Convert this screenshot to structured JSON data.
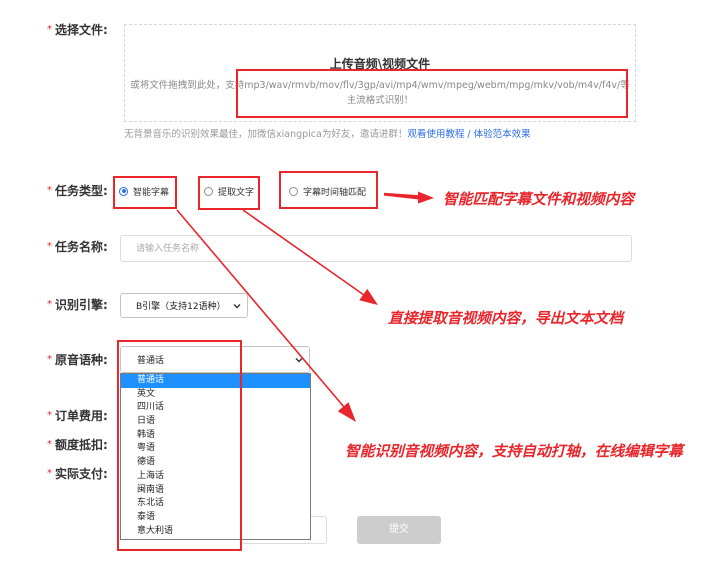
{
  "colors": {
    "annotation": "#e8262c",
    "required": "#e8262c",
    "accent": "#2f6fe4",
    "link": "#2f6fe4",
    "option_highlight": "#1e90ff",
    "submit_disabled": "#cdcdcd"
  },
  "required_mark": "*",
  "labels": {
    "file": "选择文件:",
    "task_type": "任务类型:",
    "task_name": "任务名称:",
    "engine": "识别引擎:",
    "language": "原音语种:",
    "order_fee": "订单费用:",
    "quota_deduction": "额度抵扣:",
    "actual_payment": "实际支付:"
  },
  "upload": {
    "title": "上传音频\\视频文件",
    "hint_line1": "或将文件拖拽到此处，支持mp3/wav/rmvb/mov/flv/3gp/avi/mp4/wmv/mpeg/webm/mpg/mkv/vob/m4v/f4v/等",
    "hint_line2": "主流格式识别！"
  },
  "tip": {
    "text": "无背景音乐的识别效果最佳，加微信xiangpica为好友，邀请进群！",
    "tutorial_link": "观看使用教程",
    "separator": "/",
    "sample_link": "体验范本效果"
  },
  "task_types": [
    {
      "label": "智能字幕",
      "selected": true
    },
    {
      "label": "提取文字",
      "selected": false
    },
    {
      "label": "字幕时间轴匹配",
      "selected": false
    }
  ],
  "task_name": {
    "placeholder": "请输入任务名称"
  },
  "engine": {
    "selected": "B引擎（支持12语种）"
  },
  "language": {
    "selected": "普通话",
    "options": [
      "普通话",
      "英文",
      "四川话",
      "日语",
      "韩语",
      "粤语",
      "德语",
      "上海话",
      "闽南语",
      "东北话",
      "泰语",
      "意大利语"
    ]
  },
  "actions": {
    "submit_label": "提交"
  },
  "annotations": {
    "timeline_match": "智能匹配字幕文件和视频内容",
    "extract_text": "直接提取音视频内容，导出文本文档",
    "smart_subtitle": "智能识别音视频内容，支持自动打轴，在线编辑字幕"
  }
}
